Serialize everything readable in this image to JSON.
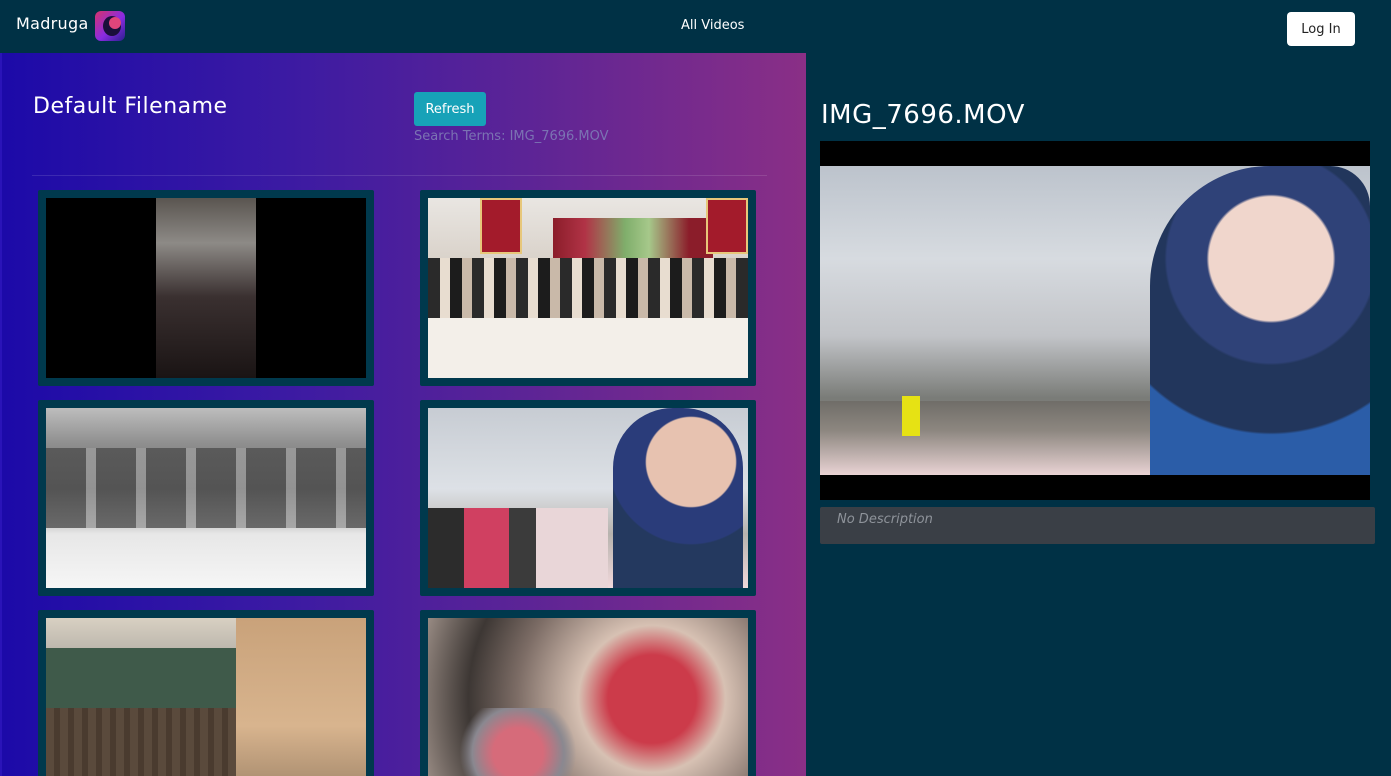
{
  "nav": {
    "brand": "Madruga",
    "link_all_videos": "All Videos",
    "login_label": "Log In"
  },
  "list": {
    "title": "Default Filename",
    "refresh_label": "Refresh",
    "search_terms": "Search Terms: IMG_7696.MOV",
    "thumbnails": [
      {
        "icon": "video-thumbnail"
      },
      {
        "icon": "video-thumbnail"
      },
      {
        "icon": "video-thumbnail"
      },
      {
        "icon": "video-thumbnail"
      },
      {
        "icon": "video-thumbnail"
      },
      {
        "icon": "video-thumbnail"
      }
    ]
  },
  "detail": {
    "title": "IMG_7696.MOV",
    "description": "No Description"
  },
  "colors": {
    "nav_bg": "#003145",
    "refresh_button": "#17a2b8",
    "tile_border": "#00394d",
    "gradient_start": "#1c0aa8",
    "gradient_end": "#8a2f86"
  }
}
